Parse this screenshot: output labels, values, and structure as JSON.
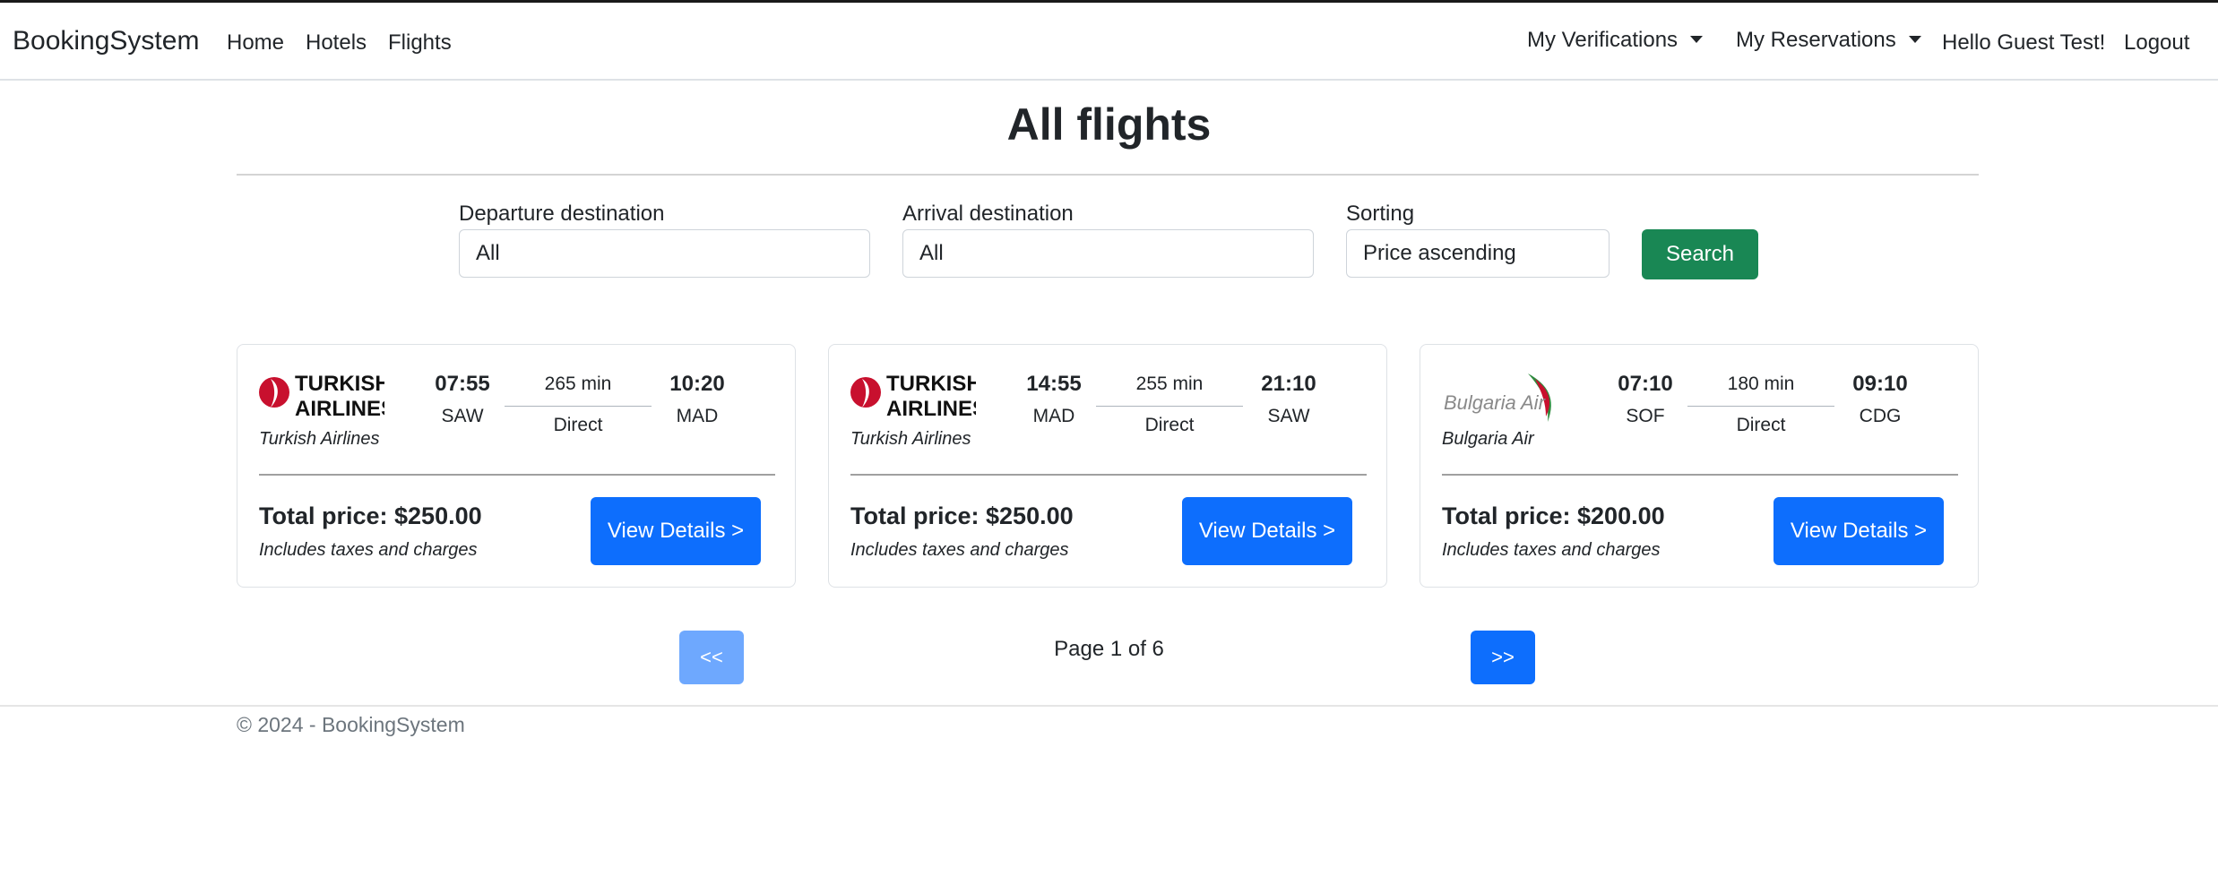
{
  "nav": {
    "brand": "BookingSystem",
    "links": [
      "Home",
      "Hotels",
      "Flights"
    ],
    "verifications": "My Verifications",
    "reservations": "My Reservations",
    "greeting": "Hello Guest Test!",
    "logout": "Logout"
  },
  "page": {
    "title": "All flights"
  },
  "filters": {
    "departure_label": "Departure destination",
    "departure_value": "All",
    "arrival_label": "Arrival destination",
    "arrival_value": "All",
    "sorting_label": "Sorting",
    "sorting_value": "Price ascending",
    "search_button": "Search"
  },
  "flights": [
    {
      "airline": "Turkish Airlines",
      "logo_text": [
        "TURKISH",
        "AIRLINES"
      ],
      "dep_time": "07:55",
      "dep_code": "SAW",
      "duration": "265 min",
      "stops": "Direct",
      "arr_time": "10:20",
      "arr_code": "MAD",
      "price": "Total price: $250.00",
      "taxes": "Includes taxes and charges",
      "button": "View Details >"
    },
    {
      "airline": "Turkish Airlines",
      "logo_text": [
        "TURKISH",
        "AIRLINES"
      ],
      "dep_time": "14:55",
      "dep_code": "MAD",
      "duration": "255 min",
      "stops": "Direct",
      "arr_time": "21:10",
      "arr_code": "SAW",
      "price": "Total price: $250.00",
      "taxes": "Includes taxes and charges",
      "button": "View Details >"
    },
    {
      "airline": "Bulgaria Air",
      "logo_text": [
        "Bulgaria Air"
      ],
      "dep_time": "07:10",
      "dep_code": "SOF",
      "duration": "180 min",
      "stops": "Direct",
      "arr_time": "09:10",
      "arr_code": "CDG",
      "price": "Total price: $200.00",
      "taxes": "Includes taxes and charges",
      "button": "View Details >"
    }
  ],
  "pagination": {
    "prev": "<<",
    "next": ">>",
    "info": "Page 1 of 6"
  },
  "footer": {
    "text": "© 2024 - BookingSystem"
  },
  "colors": {
    "primary": "#0d6efd",
    "primary_disabled": "#6ea8fe",
    "success": "#198754",
    "turkish_red": "#c8102e",
    "bulgaria_green": "#2e8b3e"
  }
}
